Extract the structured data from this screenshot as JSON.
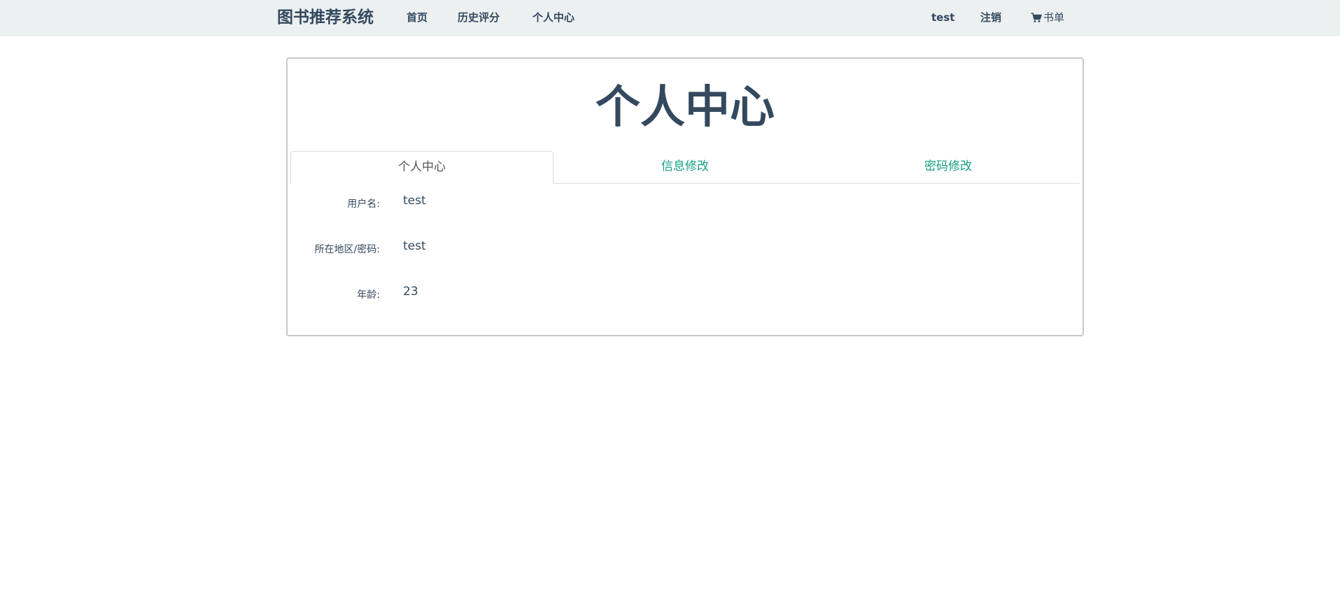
{
  "navbar": {
    "brand": "图书推荐系统",
    "links": {
      "home": "首页",
      "history": "历史评分",
      "center": "个人中心"
    },
    "user": "test",
    "logout": "注销",
    "cart": "书单",
    "cart_icon": "cart-icon"
  },
  "card": {
    "title": "个人中心",
    "tabs": [
      {
        "label": "个人中心",
        "active": true
      },
      {
        "label": "信息修改",
        "active": false
      },
      {
        "label": "密码修改",
        "active": false
      }
    ],
    "fields": [
      {
        "label": "用户名:",
        "value": "test"
      },
      {
        "label": "所在地区/密码:",
        "value": "test"
      },
      {
        "label": "年龄:",
        "value": "23"
      }
    ]
  },
  "colors": {
    "navbar_bg": "#ecf0f1",
    "text": "#34495e",
    "tab_link": "#16a085",
    "tab_active_text": "#555555"
  }
}
